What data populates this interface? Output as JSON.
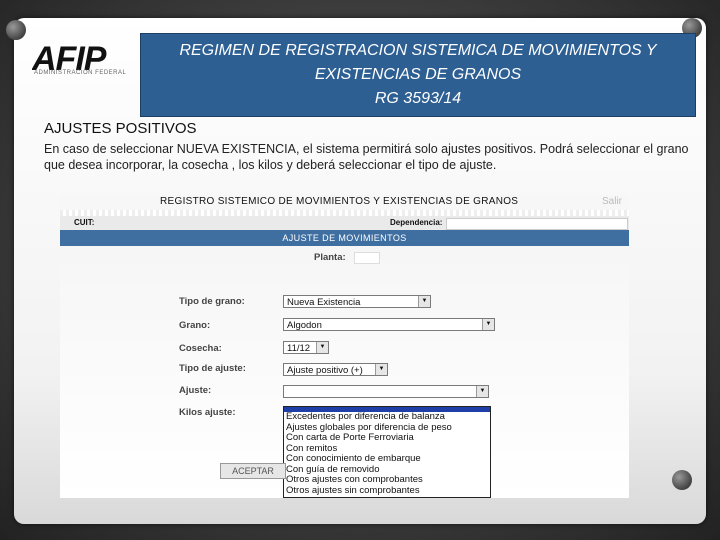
{
  "slide": {
    "logo_text": "AFIP",
    "logo_sub": "ADMINISTRACION FEDERAL",
    "title_lines": [
      "REGIMEN DE REGISTRACION SISTEMICA DE MOVIMIENTOS Y",
      "EXISTENCIAS DE GRANOS",
      "RG  3593/14"
    ],
    "section_title": "AJUSTES POSITIVOS",
    "description": "En caso de seleccionar NUEVA EXISTENCIA, el sistema permitirá solo ajustes positivos. Podrá seleccionar el grano que desea incorporar, la cosecha , los kilos y deberá seleccionar el tipo de ajuste.",
    "colors": {
      "title_bg": "#2e5f93",
      "app_header": "#3f6ea0",
      "highlight": "#1f3fa8"
    }
  },
  "app": {
    "header_title": "REGISTRO SISTEMICO DE MOVIMIENTOS Y EXISTENCIAS DE GRANOS",
    "salir": "Salir",
    "cuit_label": "CUIT:",
    "dependencia_label": "Dependencia:",
    "section_title": "AJUSTE DE MOVIMIENTOS",
    "planta_label": "Planta:",
    "form": {
      "tipo_grano_label": "Tipo de grano:",
      "tipo_grano_value": "Nueva Existencia",
      "grano_label": "Grano:",
      "grano_value": "Algodon",
      "cosecha_label": "Cosecha:",
      "cosecha_value": "11/12",
      "tipo_ajuste_label": "Tipo de ajuste:",
      "tipo_ajuste_value": "Ajuste positivo (+)",
      "ajuste_label": "Ajuste:",
      "ajuste_value": "",
      "kilos_label": "Kilos ajuste:"
    },
    "ajuste_options": [
      "Excedentes por diferencia de balanza",
      "Ajustes globales por diferencia de peso",
      "Con carta de Porte Ferroviaria",
      "Con remitos",
      "Con conocimiento de embarque",
      "Con guía de removido",
      "Otros ajustes con comprobantes",
      "Otros ajustes sin comprobantes"
    ],
    "accept_button": "ACEPTAR"
  }
}
